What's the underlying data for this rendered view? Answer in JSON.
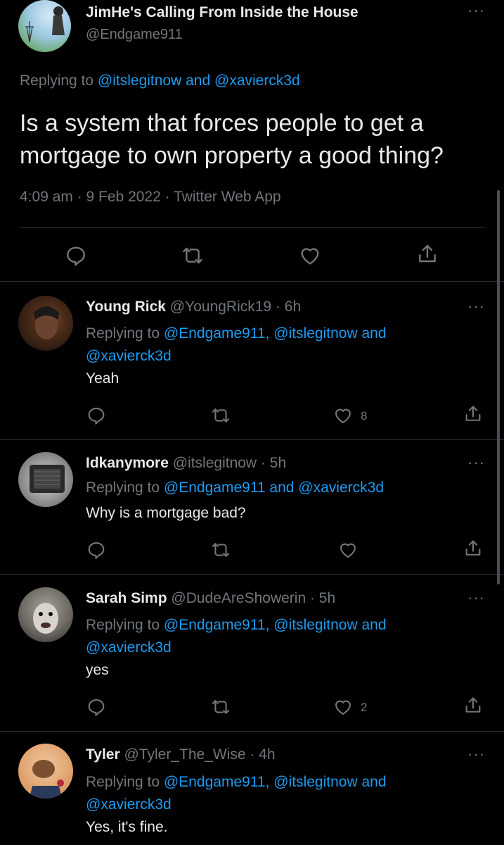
{
  "main_tweet": {
    "name": "JimHe's Calling From Inside the House",
    "handle": "@Endgame911",
    "replying_prefix": "Replying to",
    "replying_user1": "@itslegitnow",
    "replying_and": "and",
    "replying_user2": "@xavierck3d",
    "text_line1": "Is a system that forces people to get a",
    "text_line2": "mortgage to own property a good thing?",
    "timestamp": "4:09 am · 9 Feb 2022 · Twitter Web App"
  },
  "replies": [
    {
      "name": "Young Rick",
      "handle_time": "@YoungRick19 · 6h",
      "replying_prefix": "Replying to",
      "replying_line1": "@Endgame911, @itslegitnow and",
      "replying_line2": "@xavierck3d",
      "text": "Yeah",
      "likes": "8"
    },
    {
      "name": "Idkanymore",
      "handle_time": "@itslegitnow · 5h",
      "replying_prefix": "Replying to",
      "replying_line1": "@Endgame911 and @xavierck3d",
      "text": "Why is a mortgage bad?"
    },
    {
      "name": "Sarah Simp",
      "handle_time": "@DudeAreShowerin · 5h",
      "replying_prefix": "Replying to",
      "replying_line1": "@Endgame911, @itslegitnow and",
      "replying_line2": "@xavierck3d",
      "text": "yes",
      "likes": "2"
    },
    {
      "name": "Tyler",
      "handle_time": "@Tyler_The_Wise · 4h",
      "replying_prefix": "Replying to",
      "replying_line1": "@Endgame911, @itslegitnow and",
      "replying_line2": "@xavierck3d",
      "text": "Yes, it's fine."
    }
  ],
  "icons": [
    "reply-icon",
    "retweet-icon",
    "like-icon",
    "share-icon",
    "more-icon"
  ],
  "colors": {
    "background": "#000000",
    "text": "#e7e9ea",
    "muted": "#71767b",
    "link": "#1d9bf0",
    "divider": "#2f3336"
  }
}
